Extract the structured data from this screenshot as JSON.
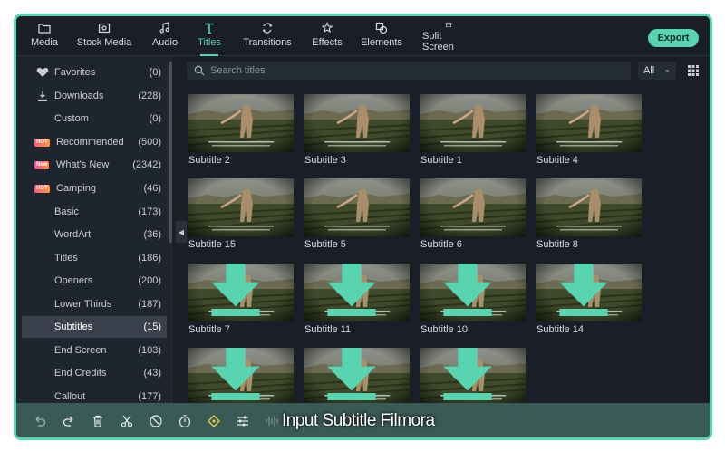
{
  "topbar": {
    "tabs": [
      {
        "label": "Media",
        "icon": "folder-icon"
      },
      {
        "label": "Stock Media",
        "icon": "stock-media-icon"
      },
      {
        "label": "Audio",
        "icon": "music-note-icon"
      },
      {
        "label": "Titles",
        "icon": "titles-icon",
        "active": true
      },
      {
        "label": "Transitions",
        "icon": "transitions-icon"
      },
      {
        "label": "Effects",
        "icon": "effects-icon"
      },
      {
        "label": "Elements",
        "icon": "elements-icon"
      },
      {
        "label": "Split Screen",
        "icon": "split-screen-icon"
      }
    ],
    "export_label": "Export"
  },
  "sidebar": {
    "items": [
      {
        "label": "Favorites",
        "count": "(0)",
        "icon": "heart-icon"
      },
      {
        "label": "Downloads",
        "count": "(228)",
        "icon": "download-icon"
      },
      {
        "label": "Custom",
        "count": "(0)"
      },
      {
        "label": "Recommended",
        "count": "(500)",
        "badge": "HOT"
      },
      {
        "label": "What's New",
        "count": "(2342)",
        "badge": "New"
      },
      {
        "label": "Camping",
        "count": "(46)",
        "badge": "HOT"
      },
      {
        "label": "Basic",
        "count": "(173)"
      },
      {
        "label": "WordArt",
        "count": "(36)"
      },
      {
        "label": "Titles",
        "count": "(186)"
      },
      {
        "label": "Openers",
        "count": "(200)"
      },
      {
        "label": "Lower Thirds",
        "count": "(187)"
      },
      {
        "label": "Subtitles",
        "count": "(15)",
        "selected": true
      },
      {
        "label": "End Screen",
        "count": "(103)"
      },
      {
        "label": "End Credits",
        "count": "(43)"
      },
      {
        "label": "Callout",
        "count": "(177)"
      }
    ]
  },
  "search": {
    "placeholder": "Search titles"
  },
  "filter": {
    "value": "All"
  },
  "grid": {
    "items": [
      {
        "caption": "Subtitle 2"
      },
      {
        "caption": "Subtitle 3"
      },
      {
        "caption": "Subtitle 1"
      },
      {
        "caption": "Subtitle 4"
      },
      {
        "caption": "Subtitle 15"
      },
      {
        "caption": "Subtitle 5"
      },
      {
        "caption": "Subtitle 6"
      },
      {
        "caption": "Subtitle 8"
      },
      {
        "caption": "Subtitle 7",
        "download": true
      },
      {
        "caption": "Subtitle 11",
        "download": true
      },
      {
        "caption": "Subtitle 10",
        "download": true
      },
      {
        "caption": "Subtitle 14",
        "download": true
      },
      {
        "caption": "",
        "download": true
      },
      {
        "caption": "",
        "download": true
      },
      {
        "caption": "",
        "download": true
      }
    ]
  },
  "bottombar": {
    "icons": [
      "undo-icon",
      "redo-icon",
      "delete-icon",
      "cut-icon",
      "unlink-icon",
      "speed-icon",
      "keyframe-icon",
      "adjust-icon",
      "audio-wave-icon"
    ],
    "watermark": "Input Subtitle Filmora"
  },
  "colors": {
    "accent": "#58d4b0",
    "background": "#1a1f27",
    "sidebar": "#1f252e",
    "selected_row": "#3a414c",
    "bottombar": "#3a5a55"
  }
}
